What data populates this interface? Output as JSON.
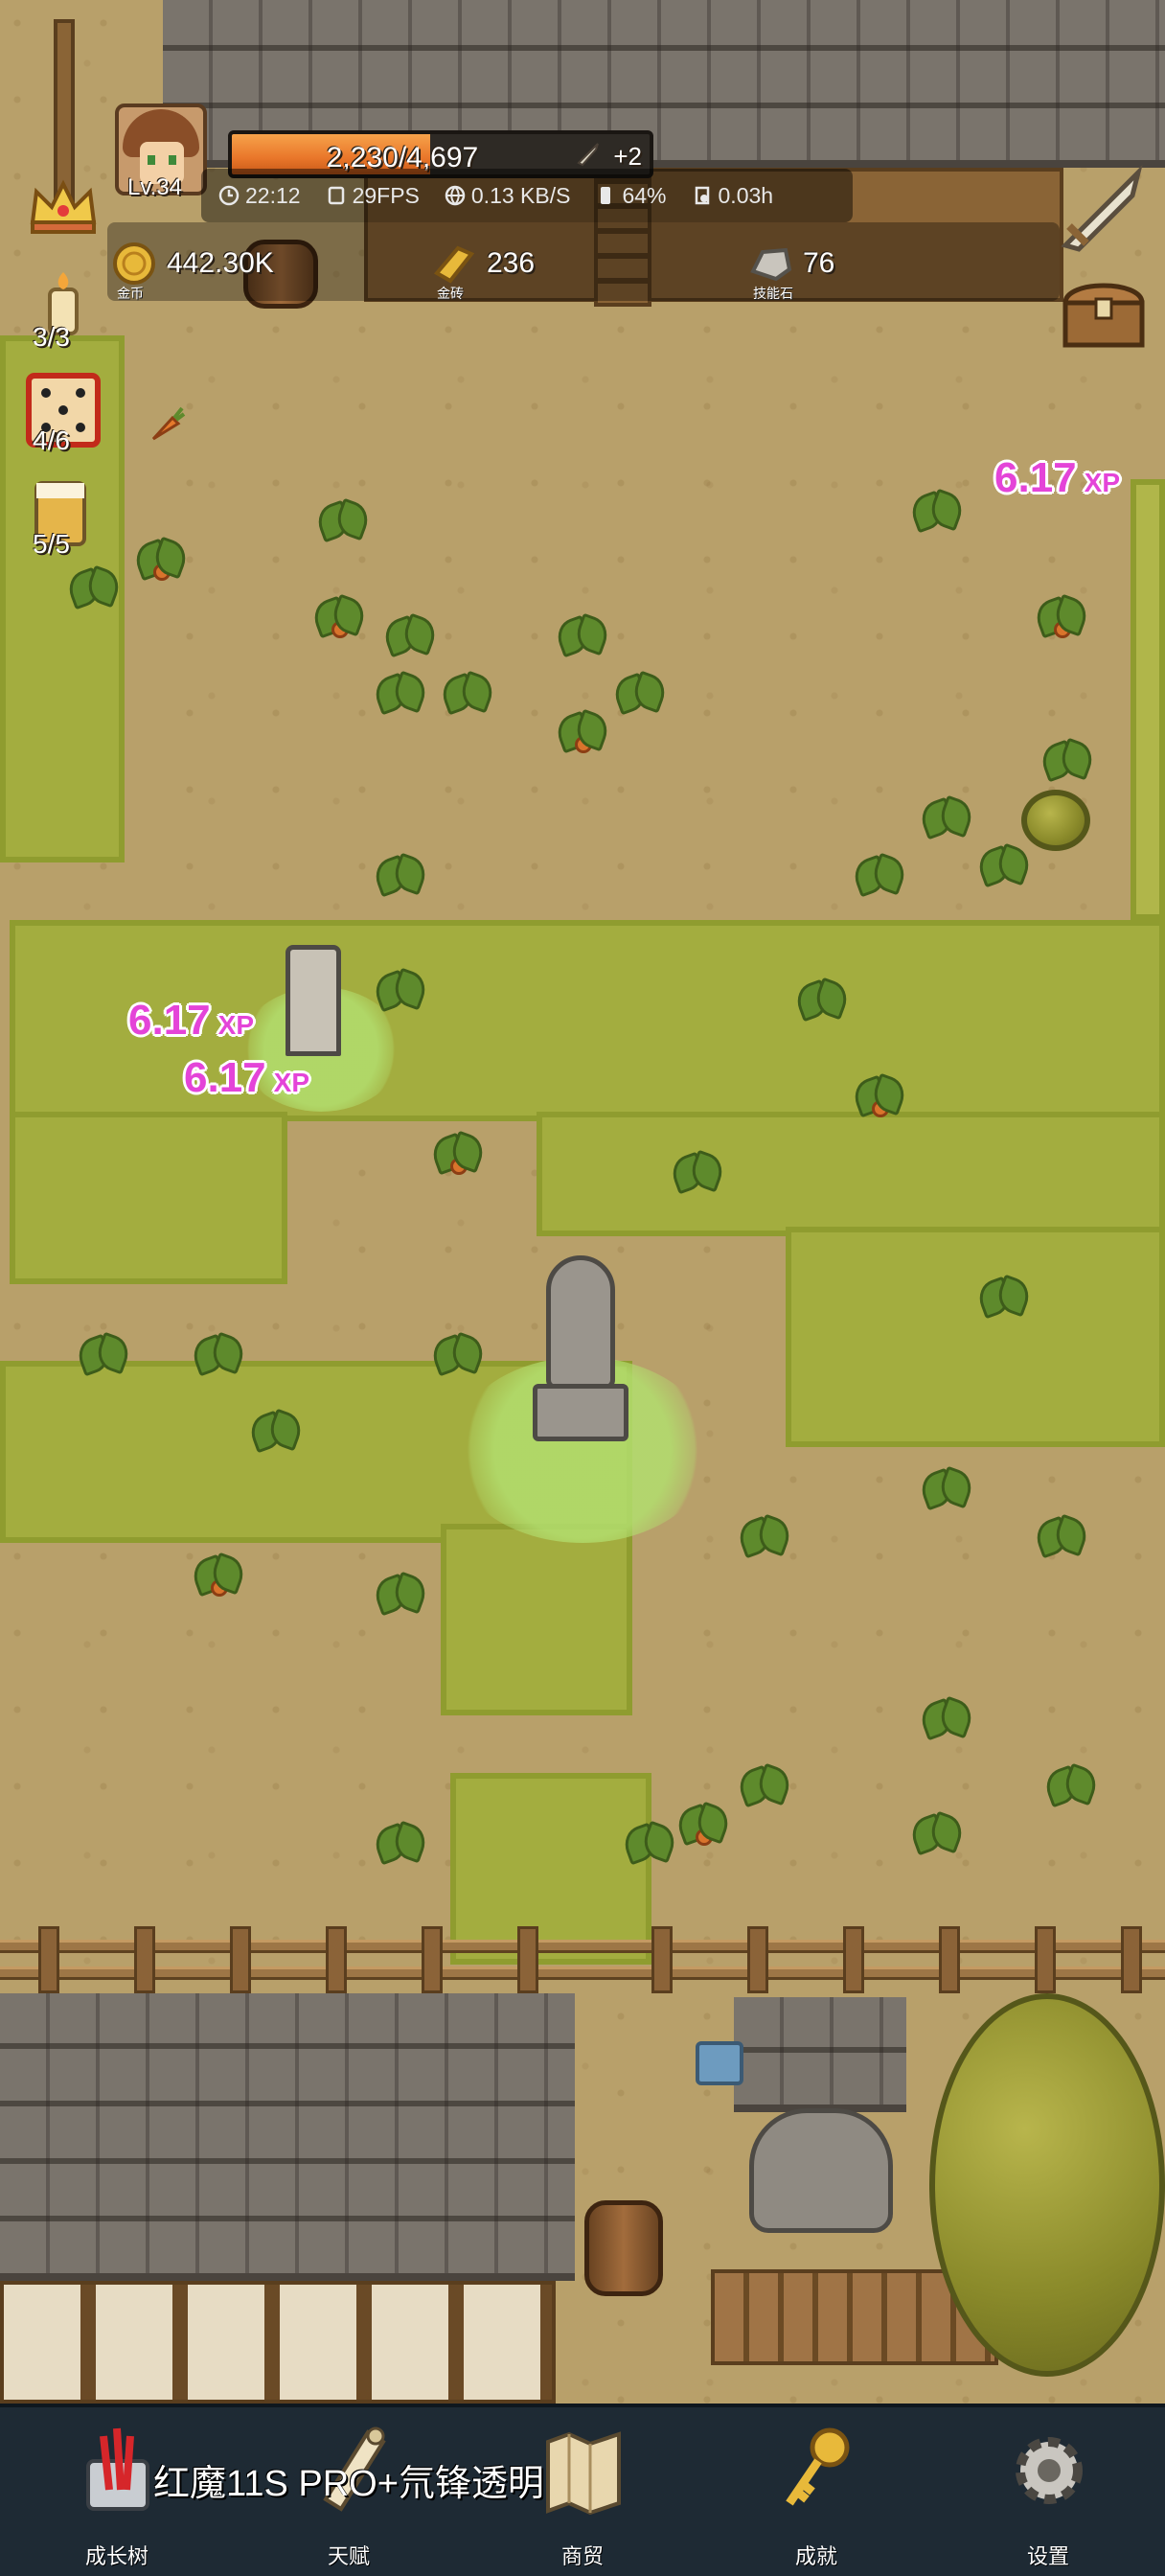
{
  "player": {
    "level": "Lv.34",
    "hp_text": "2,230/4,697",
    "hp_fraction": 0.475,
    "weapon_bonus": "+2"
  },
  "status": {
    "time": "22:12",
    "fps": "29FPS",
    "network": "0.13 KB/S",
    "battery": "64%",
    "duration": "0.03h"
  },
  "resources": [
    {
      "icon": "gold-coin-icon",
      "value": "442.30K",
      "caption": "金币"
    },
    {
      "icon": "gold-brick-icon",
      "value": "236",
      "caption": "金砖"
    },
    {
      "icon": "skill-stone-icon",
      "value": "76",
      "caption": "技能石"
    }
  ],
  "buffs": [
    {
      "icon": "crown-icon",
      "count": ""
    },
    {
      "icon": "candle-icon",
      "count": "3/3"
    },
    {
      "icon": "dice-icon",
      "count": "4/6"
    },
    {
      "icon": "beer-mug-icon",
      "count": "5/5"
    }
  ],
  "xp_popups": [
    {
      "value": "6.17",
      "unit": "XP"
    },
    {
      "value": "6.17",
      "unit": "XP"
    },
    {
      "value": "6.17",
      "unit": "XP"
    }
  ],
  "nav": [
    {
      "icon": "growth-tree-icon",
      "label": "成长树"
    },
    {
      "icon": "talent-scroll-icon",
      "label": "天赋"
    },
    {
      "icon": "trade-map-icon",
      "label": "商贸"
    },
    {
      "icon": "achievement-key-icon",
      "label": "成就"
    },
    {
      "icon": "settings-gear-icon",
      "label": "设置"
    }
  ],
  "device_overlay": "红魔11S PRO+氘锋透明",
  "colors": {
    "hp_fill": "#e9762a",
    "xp_text": "#e444d8",
    "nav_bg": "#1e2a34"
  }
}
